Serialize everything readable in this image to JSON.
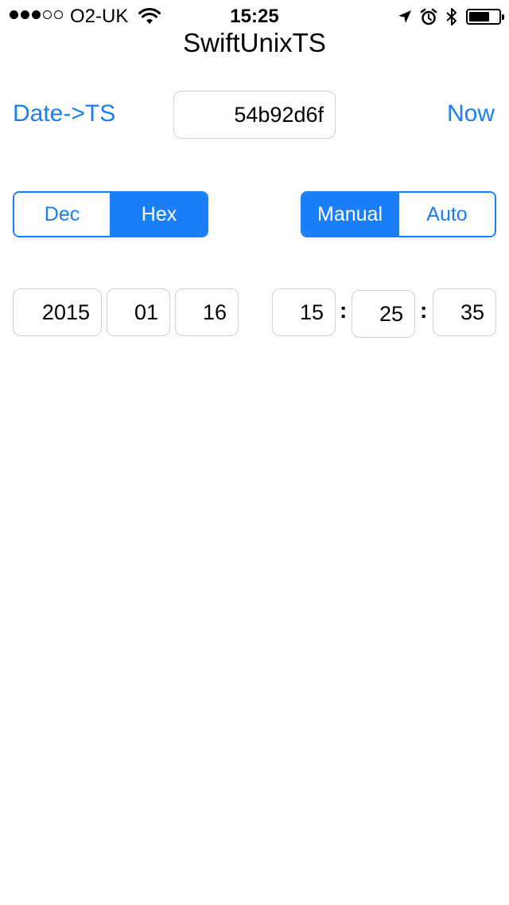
{
  "status_bar": {
    "signal_dots_filled": 3,
    "signal_dots_total": 5,
    "carrier": "O2-UK",
    "time": "15:25",
    "battery_level": 0.7,
    "icons": [
      "wifi-icon",
      "location-arrow-icon",
      "alarm-icon",
      "bluetooth-icon",
      "battery-icon"
    ]
  },
  "header": {
    "title": "SwiftUnixTS"
  },
  "converter": {
    "date_to_ts_label": "Date->TS",
    "timestamp_value": "54b92d6f",
    "now_label": "Now"
  },
  "base_toggle": {
    "options": [
      "Dec",
      "Hex"
    ],
    "selected": "Hex"
  },
  "mode_toggle": {
    "options": [
      "Manual",
      "Auto"
    ],
    "selected": "Manual"
  },
  "date": {
    "year": "2015",
    "month": "01",
    "day": "16"
  },
  "time": {
    "hour": "15",
    "minute": "25",
    "second": "35",
    "separator": ":"
  },
  "colors": {
    "accent": "#1a7ff7",
    "field_border": "#cfcfcf",
    "background": "#ffffff"
  }
}
